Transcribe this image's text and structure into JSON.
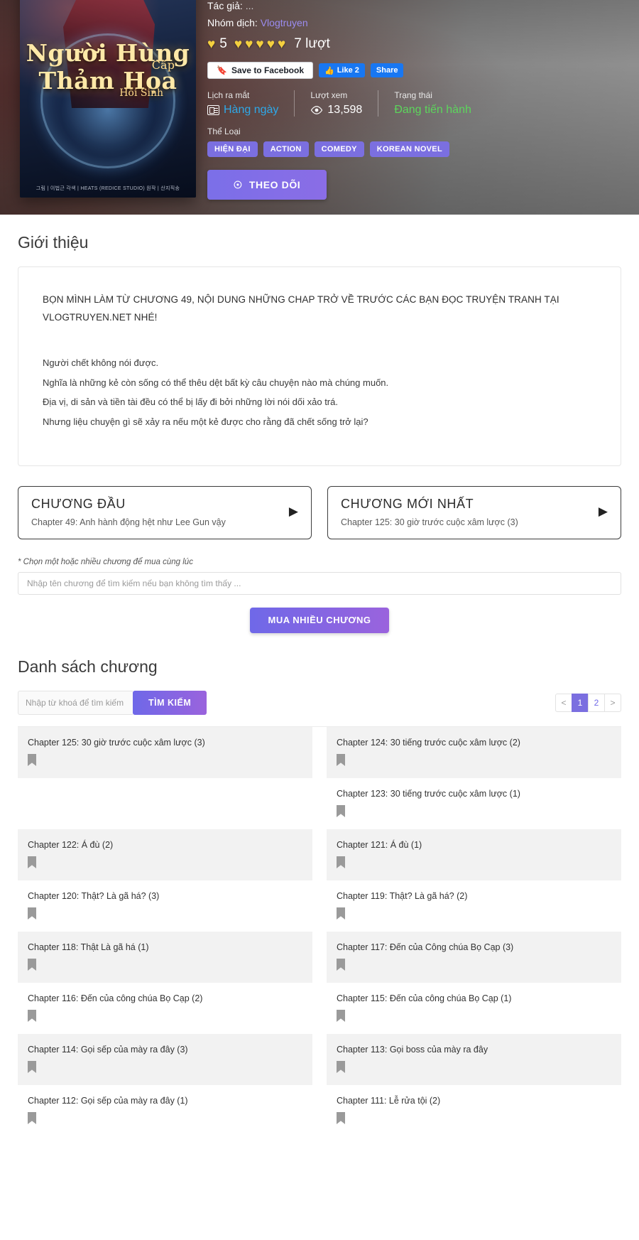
{
  "hero": {
    "cover": {
      "title_line1": "Người Hùng",
      "title_line2": "Thảm Họa",
      "badge_small1": "Cấp",
      "badge_small2": "Hồi Sinh",
      "credits": "그림 | 이법근     각색 | HEATS (REDICE STUDIO)     원작 | 산지직송"
    },
    "author_label": "Tác giả:",
    "author_value": "...",
    "group_label": "Nhóm dịch:",
    "group_value": "Vlogtruyen",
    "rating_value": "5",
    "rating_count": "7 lượt",
    "hearts_left": 1,
    "hearts_right": 5,
    "facebook": {
      "save_label": "Save to Facebook",
      "like_label": "Like 2",
      "share_label": "Share"
    },
    "stats": [
      {
        "label": "Lịch ra mắt",
        "value": "Hàng ngày",
        "icon": "calendar-icon",
        "color": "blue"
      },
      {
        "label": "Lượt xem",
        "value": "13,598",
        "icon": "eye-icon",
        "color": "white"
      },
      {
        "label": "Trạng thái",
        "value": "Đang tiến hành",
        "icon": "",
        "color": "green"
      }
    ],
    "genre_label": "Thể Loại",
    "genres": [
      "HIỆN ĐẠI",
      "ACTION",
      "COMEDY",
      "KOREAN NOVEL"
    ],
    "follow_label": "THEO DÕI",
    "follow_icon": "bell-icon"
  },
  "intro": {
    "title": "Giới thiệu",
    "headline": "BỌN MÌNH LÀM TỪ CHƯƠNG 49, NỘI DUNG NHỮNG CHAP TRỞ VỀ TRƯỚC CÁC BẠN ĐỌC TRUYỆN TRANH TẠI VLOGTRUYEN.NET NHÉ!",
    "paragraphs": [
      "Người chết không nói được.",
      "Nghĩa là những kẻ còn sống có thể thêu dệt bất kỳ câu chuyện nào mà chúng muốn.",
      "Địa vị, di sản và tiền tài đều có thể bị lấy đi bởi những lời nói dối xảo trá.",
      "Nhưng liệu chuyện gì sẽ xảy ra nếu một kẻ được cho rằng đã chết sống trở lại?"
    ]
  },
  "chapter_nav": {
    "first": {
      "title": "CHƯƠNG ĐẦU",
      "subtitle": "Chapter 49: Anh hành động hệt như Lee Gun vậy",
      "arrow": "▶"
    },
    "latest": {
      "title": "CHƯƠNG MỚI NHẤT",
      "subtitle": "Chapter 125: 30 giờ trước cuộc xâm lược (3)",
      "arrow": "▶"
    }
  },
  "buy": {
    "hint": "* Chọn một hoặc nhiều chương để mua cùng lúc",
    "input_placeholder": "Nhập tên chương để tìm kiếm nếu bạn không tìm thấy ...",
    "input_value": "",
    "button_label": "MUA NHIỀU CHƯƠNG"
  },
  "chapter_list": {
    "title": "Danh sách chương",
    "search_placeholder": "Nhập từ khoá để tìm kiếm ...",
    "search_value": "",
    "search_button": "TÌM KIẾM",
    "pager": {
      "prev": "<",
      "next": ">",
      "pages": [
        "1",
        "2"
      ],
      "active": "1"
    },
    "items": [
      {
        "name": "Chapter 125: 30 giờ trước cuộc xâm lược (3)",
        "alt": true
      },
      {
        "name": "Chapter 124: 30 tiếng trước cuộc xâm lược (2)",
        "alt": true
      },
      {
        "name": "",
        "alt": false
      },
      {
        "name": "Chapter 123: 30 tiếng trước cuộc xâm lược (1)",
        "alt": false
      },
      {
        "name": "Chapter 122: Á đù (2)",
        "alt": true
      },
      {
        "name": "Chapter 121: Á đù (1)",
        "alt": true
      },
      {
        "name": "Chapter 120: Thật? Là gã há? (3)",
        "alt": false
      },
      {
        "name": "Chapter 119: Thật? Là gã há? (2)",
        "alt": false
      },
      {
        "name": "Chapter 118: Thật Là gã há (1)",
        "alt": true
      },
      {
        "name": "Chapter 117: Đến của Công chúa Bọ Cạp (3)",
        "alt": true
      },
      {
        "name": "Chapter 116: Đến của công chúa Bọ Cạp (2)",
        "alt": false
      },
      {
        "name": "Chapter 115: Đến của công chúa Bọ Cạp (1)",
        "alt": false
      },
      {
        "name": "Chapter 114: Gọi sếp của mày ra đây (3)",
        "alt": true
      },
      {
        "name": "Chapter 113: Gọi boss của mày ra đây",
        "alt": true
      },
      {
        "name": "Chapter 112: Gọi sếp của mày ra đây (1)",
        "alt": false
      },
      {
        "name": "Chapter 111: Lễ rửa tội (2)",
        "alt": false
      }
    ]
  }
}
